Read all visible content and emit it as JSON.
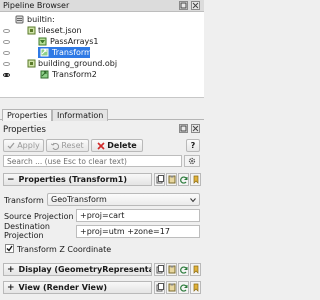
{
  "pipeline_browser": {
    "title": "Pipeline Browser",
    "items": [
      {
        "label": "builtin:"
      },
      {
        "label": "tileset.json"
      },
      {
        "label": "PassArrays1"
      },
      {
        "label": "Transform1"
      },
      {
        "label": "building_ground.obj"
      },
      {
        "label": "Transform2"
      }
    ]
  },
  "tabs": [
    {
      "label": "Properties"
    },
    {
      "label": "Information"
    }
  ],
  "properties_panel": {
    "title": "Properties",
    "apply_label": "Apply",
    "reset_label": "Reset",
    "delete_label": "Delete",
    "help_label": "?",
    "search_placeholder": "Search ... (use Esc to clear text)",
    "group_properties": "Properties (Transform1)",
    "transform_label": "Transform",
    "transform_value": "GeoTransform",
    "source_projection_label": "Source Projection",
    "source_projection_value": "+proj=cart",
    "destination_projection_label_1": "Destination",
    "destination_projection_label_2": "Projection",
    "destination_projection_value": "+proj=utm +zone=17",
    "transform_z_label": "Transform Z Coordinate",
    "group_display": "Display (GeometryRepresentation)",
    "group_view": "View (Render View)"
  },
  "colors": {
    "selection": "#2f7ae5",
    "delete_red": "#d12a2a",
    "apply_green": "#3a8f3a"
  }
}
